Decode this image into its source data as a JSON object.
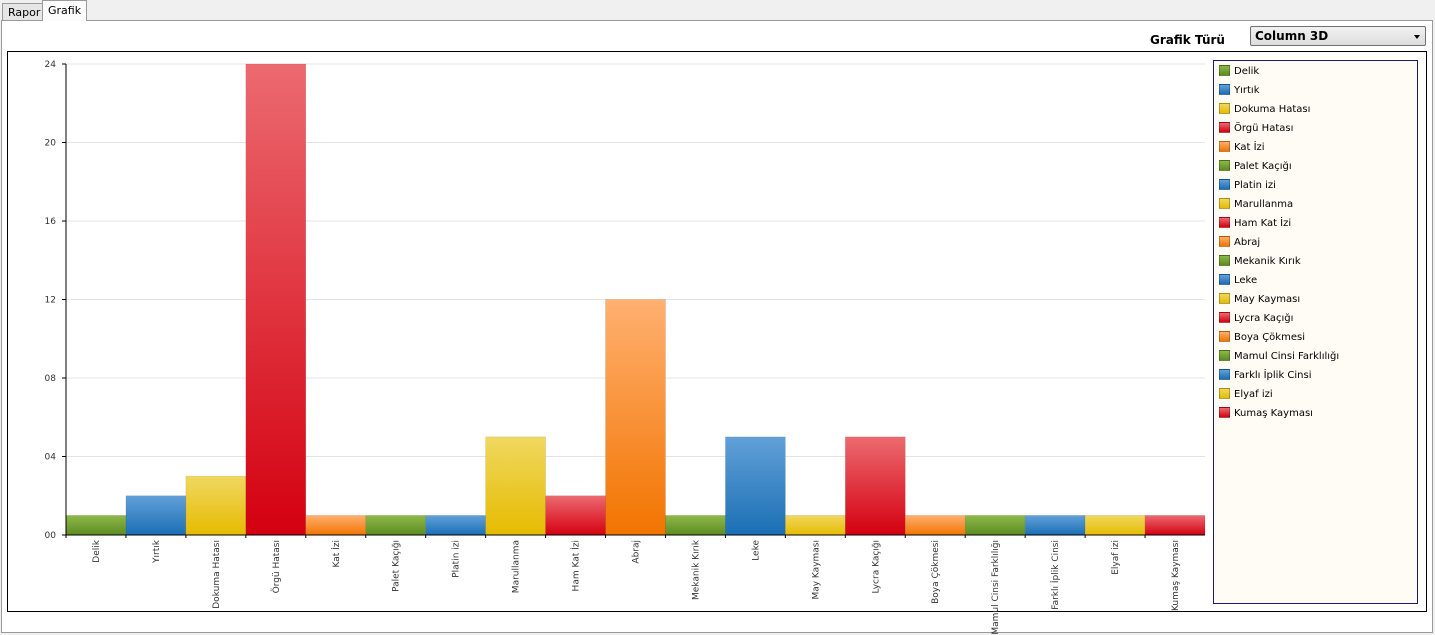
{
  "tabs": [
    {
      "label": "Rapor",
      "active": false
    },
    {
      "label": "Grafik",
      "active": true
    }
  ],
  "controls": {
    "chart_type_label": "Grafik Türü",
    "chart_type_value": "Column 3D"
  },
  "palette": {
    "green": [
      "#8db84a",
      "#5e8c22"
    ],
    "blue": [
      "#62a0d8",
      "#1a6fb5"
    ],
    "yellow": [
      "#f0d860",
      "#e6bb00"
    ],
    "red": [
      "#ec6a70",
      "#d40010"
    ],
    "orange": [
      "#ffb070",
      "#f27400"
    ]
  },
  "chart_data": {
    "type": "bar",
    "ylim": [
      0,
      24
    ],
    "yticks": [
      "00",
      "04",
      "08",
      "12",
      "16",
      "20",
      "24"
    ],
    "ytick_values": [
      0,
      4,
      8,
      12,
      16,
      20,
      24
    ],
    "grid": true,
    "legend_position": "right",
    "categories": [
      "Delik",
      "Yırtık",
      "Dokuma Hatası",
      "Örgü Hatası",
      "Kat İzi",
      "Palet Kaçığı",
      "Platin izi",
      "Marullanma",
      "Ham Kat İzi",
      "Abraj",
      "Mekanik Kırık",
      "Leke",
      "May Kayması",
      "Lycra Kaçığı",
      "Boya Çökmesi",
      "Mamul Cinsi Farklılığı",
      "Farklı İplik Cinsi",
      "Elyaf izi",
      "Kumaş Kayması"
    ],
    "values": [
      1,
      2,
      3,
      24,
      1,
      1,
      1,
      5,
      2,
      12,
      1,
      5,
      1,
      5,
      1,
      1,
      1,
      1,
      1
    ],
    "colors": [
      "green",
      "blue",
      "yellow",
      "red",
      "orange",
      "green",
      "blue",
      "yellow",
      "red",
      "orange",
      "green",
      "blue",
      "yellow",
      "red",
      "orange",
      "green",
      "blue",
      "yellow",
      "red"
    ]
  }
}
